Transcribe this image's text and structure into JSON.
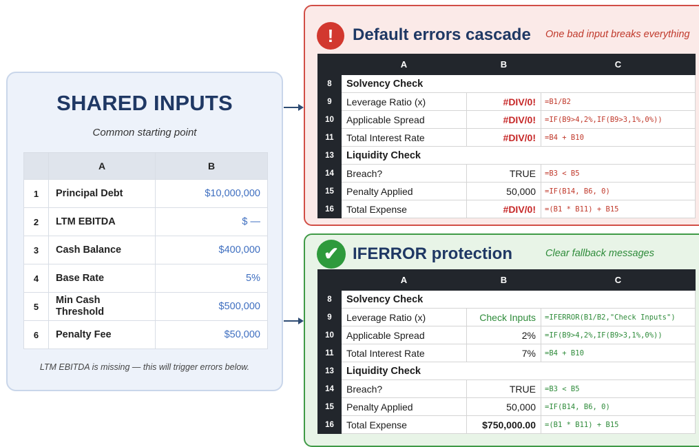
{
  "inputs": {
    "title": "SHARED INPUTS",
    "subtitle": "Common starting point",
    "columns": [
      "A",
      "B"
    ],
    "rows": [
      {
        "num": "1",
        "label": "Principal Debt",
        "value": "$10,000,000"
      },
      {
        "num": "2",
        "label": "LTM EBITDA",
        "value": "$ —"
      },
      {
        "num": "3",
        "label": "Cash Balance",
        "value": "$400,000"
      },
      {
        "num": "4",
        "label": "Base Rate",
        "value": "5%"
      },
      {
        "num": "5",
        "label": "Min Cash Threshold",
        "value": "$500,000"
      },
      {
        "num": "6",
        "label": "Penalty Fee",
        "value": "$50,000"
      }
    ],
    "note": "LTM EBITDA is missing — this will trigger errors below."
  },
  "error_panel": {
    "badge": "!",
    "title": "Default errors cascade",
    "tagline": "One bad input breaks everything",
    "columns": [
      "A",
      "B",
      "C"
    ],
    "rows": [
      {
        "num": "8",
        "section": "Solvency Check"
      },
      {
        "num": "9",
        "label": "Leverage Ratio (x)",
        "value": "#DIV/0!",
        "formula": "=B1/B2"
      },
      {
        "num": "10",
        "label": "Applicable Spread",
        "value": "#DIV/0!",
        "formula": "=IF(B9>4,2%,IF(B9>3,1%,0%))"
      },
      {
        "num": "11",
        "label": "Total Interest Rate",
        "value": "#DIV/0!",
        "formula": "=B4 + B10"
      },
      {
        "num": "13",
        "section": "Liquidity Check"
      },
      {
        "num": "14",
        "label": "Breach?",
        "value": "TRUE",
        "formula": "=B3 < B5"
      },
      {
        "num": "15",
        "label": "Penalty Applied",
        "value": "50,000",
        "formula": "=IF(B14, B6, 0)"
      },
      {
        "num": "16",
        "label": "Total Expense",
        "value": "#DIV/0!",
        "formula": "=(B1 * B11) + B15"
      }
    ]
  },
  "ok_panel": {
    "badge": "✔",
    "title": "IFERROR protection",
    "tagline": "Clear fallback messages",
    "columns": [
      "A",
      "B",
      "C"
    ],
    "rows": [
      {
        "num": "8",
        "section": "Solvency Check"
      },
      {
        "num": "9",
        "label": "Leverage Ratio (x)",
        "value": "Check Inputs",
        "formula": "=IFERROR(B1/B2,\"Check Inputs\")"
      },
      {
        "num": "10",
        "label": "Applicable Spread",
        "value": "2%",
        "formula": "=IF(B9>4,2%,IF(B9>3,1%,0%))"
      },
      {
        "num": "11",
        "label": "Total Interest Rate",
        "value": "7%",
        "formula": "=B4 + B10"
      },
      {
        "num": "13",
        "section": "Liquidity Check"
      },
      {
        "num": "14",
        "label": "Breach?",
        "value": "TRUE",
        "formula": "=B3 < B5"
      },
      {
        "num": "15",
        "label": "Penalty Applied",
        "value": "50,000",
        "formula": "=IF(B14, B6, 0)"
      },
      {
        "num": "16",
        "label": "Total Expense",
        "value": "$750,000.00",
        "formula": "=(B1 * B11) + B15"
      }
    ]
  },
  "colors": {
    "title_navy": "#1f3864",
    "error_red": "#c62828",
    "ok_green": "#2e8b3a",
    "input_blue": "#3f6fc0",
    "header_dark": "#22262c"
  }
}
